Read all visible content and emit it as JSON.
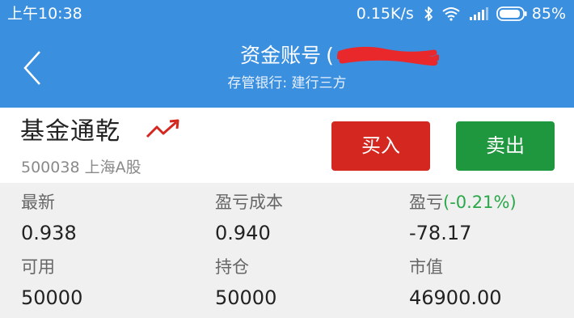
{
  "status_bar": {
    "time": "上午10:38",
    "network_speed": "0.15K/s",
    "battery": "85%",
    "icons": [
      "bluetooth-icon",
      "wifi-icon",
      "signal-icon",
      "battery-icon"
    ]
  },
  "header": {
    "title": "资金账号",
    "title_suffix": "(",
    "subtitle": "存管银行: 建行三方",
    "back_icon": "chevron-left-icon"
  },
  "fund": {
    "name": "基金通乾",
    "code_market": "500038 上海A股",
    "trend_icon": "trend-up-icon",
    "buy_label": "买入",
    "sell_label": "卖出"
  },
  "stats": {
    "latest_label": "最新",
    "latest_value": "0.938",
    "cost_label": "盈亏成本",
    "cost_value": "0.940",
    "pnl_label": "盈亏",
    "pnl_pct": "(-0.21%)",
    "pnl_value": "-78.17",
    "available_label": "可用",
    "available_value": "50000",
    "position_label": "持仓",
    "position_value": "50000",
    "market_value_label": "市值",
    "market_value_value": "46900.00"
  },
  "colors": {
    "header_blue": "#3b8fdf",
    "buy_red": "#d4271f",
    "sell_green": "#1e973f",
    "loss_green": "#2aa84a",
    "stats_bg": "#f0f0f0"
  }
}
